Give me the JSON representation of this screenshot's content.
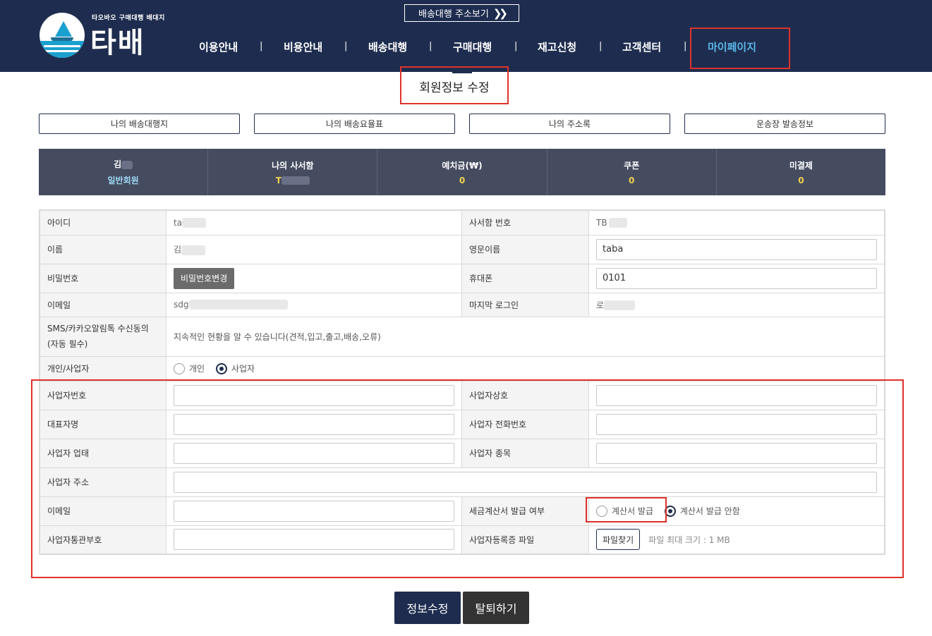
{
  "header": {
    "logo_sub": "타오바오 구매대행 배대지",
    "logo_main": "타배",
    "shipping_button": "배송대행 주소보기",
    "nav": [
      "이용안내",
      "비용안내",
      "배송대행",
      "구매대행",
      "재고신청",
      "고객센터",
      "마이페이지"
    ],
    "nav_separator": "|"
  },
  "page_title": "회원정보 수정",
  "quick_buttons": [
    "나의 배송대행지",
    "나의 배송요율표",
    "나의 주소록",
    "운송장 발송정보"
  ],
  "stats": {
    "member_name": "김",
    "member_grade": "일반회원",
    "mailbox_label": "나의 사서함",
    "mailbox_value": "T",
    "deposit_label": "예치금(₩)",
    "deposit_value": "0",
    "coupon_label": "쿠폰",
    "coupon_value": "0",
    "unpaid_label": "미결제",
    "unpaid_value": "0"
  },
  "form": {
    "id_label": "아이디",
    "id_value": "ta",
    "mailbox_no_label": "사서함 번호",
    "mailbox_no_value": "TB",
    "name_label": "이름",
    "name_value": "김",
    "eng_name_label": "영문이름",
    "eng_name_value": "taba",
    "password_label": "비밀번호",
    "password_button": "비밀번호변경",
    "phone_label": "휴대폰",
    "phone_value": "0101",
    "email_label": "이메일",
    "email_value": "sdg",
    "last_login_label": "마지막 로그인",
    "last_login_value": "로",
    "sms_label": "SMS/카카오알림톡 수신동의 (자동 필수)",
    "sms_value": "지속적인 현황을 알 수 있습니다(견적,입고,출고,배송,오류)",
    "type_label": "개인/사업자",
    "type_personal": "개인",
    "type_business": "사업자",
    "biz_no_label": "사업자번호",
    "biz_name_label": "사업자상호",
    "ceo_label": "대표자명",
    "biz_phone_label": "사업자 전화번호",
    "biz_type_label": "사업자 업태",
    "biz_item_label": "사업자 종목",
    "biz_address_label": "사업자 주소",
    "biz_email_label": "이메일",
    "tax_invoice_label": "세금계산서 발급 여부",
    "tax_invoice_yes": "계산서 발급",
    "tax_invoice_no": "계산서 발급 안함",
    "customs_no_label": "사업자통관부호",
    "biz_file_label": "사업자등록증 파일",
    "file_button": "파일찾기",
    "file_note": "파일 최대 크기 : 1 MB"
  },
  "actions": {
    "save": "정보수정",
    "withdraw": "탈퇴하기"
  },
  "colors": {
    "header_bg": "#1e2d4f",
    "active_nav": "#5ab6e8",
    "stats_bg": "#454c60",
    "stat_value": "#f2d14a",
    "highlight": "#e0312b",
    "withdraw_bg": "#333333"
  }
}
